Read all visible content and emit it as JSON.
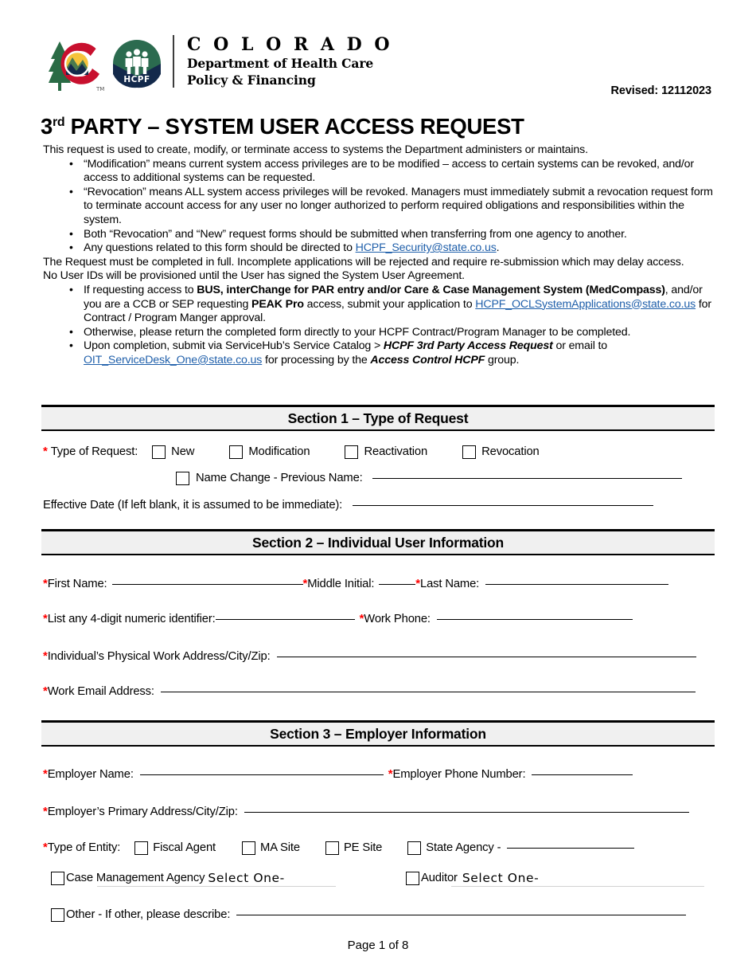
{
  "logo": {
    "colorado_wordmark": "C O L O R A D O",
    "department_line1": "Department of Health Care",
    "department_line2": "Policy & Financing",
    "hcpf_label": "HCPF",
    "colors": {
      "red": "#c8102e",
      "gold": "#ffc425",
      "navy": "#13294b",
      "green": "#1e5c3f",
      "dark_green": "#2b6b4f"
    }
  },
  "revised": "Revised: 12112023",
  "title": {
    "prefix": "3",
    "sup": "rd",
    "rest": " PARTY – SYSTEM USER ACCESS REQUEST"
  },
  "intro": {
    "lead": "This request is used to create, modify, or terminate access to systems the Department administers or maintains.",
    "bullets": [
      "“Modification” means current system access privileges are to be modified – access to certain systems can be revoked, and/or access to additional systems can be requested.",
      "“Revocation” means ALL system access privileges will be revoked. Managers must immediately submit a revocation request form to terminate account access for any user no longer authorized to perform required obligations and responsibilities within the system.",
      "Both “Revocation” and “New” request forms should be submitted when transferring from one agency to another."
    ],
    "bullet_question_prefix": "Any questions related to this form should be directed to ",
    "bullet_question_email": "HCPF_Security@state.co.us",
    "bullet_question_suffix": ".",
    "para2_line1": "The Request must be completed in full. Incomplete applications will be rejected and require re-submission which may delay access.",
    "para2_line2": "No User IDs will be provisioned until the User has signed the System User Agreement.",
    "bullet_bus_p1": "If requesting access to ",
    "bullet_bus_b1": "BUS, interChange for PAR entry and/or Care & Case Management System (MedCompass)",
    "bullet_bus_p2": ", and/or you are a CCB or SEP requesting ",
    "bullet_bus_b2": "PEAK Pro",
    "bullet_bus_p3": " access, submit your application to ",
    "bullet_bus_email": "HCPF_OCLSystemApplications@state.co.us",
    "bullet_bus_p4": " for Contract / Program Manger approval.",
    "bullet_otherwise": "Otherwise, please return the completed form directly to your HCPF Contract/Program Manager to be completed.",
    "bullet_submit_p1": "Upon completion, submit via ServiceHub’s Service Catalog > ",
    "bullet_submit_b1": "HCPF 3rd Party Access Request",
    "bullet_submit_p2": " or email to ",
    "bullet_submit_email": "OIT_ServiceDesk_One@state.co.us",
    "bullet_submit_p3": " for processing by the ",
    "bullet_submit_b2": "Access Control HCPF",
    "bullet_submit_p4": " group."
  },
  "section1": {
    "heading": "Section 1 – Type of Request",
    "type_label": "Type of Request:",
    "options": [
      "New",
      "Modification",
      "Reactivation",
      "Revocation"
    ],
    "name_change_label": "Name Change - Previous Name:",
    "effective_date_label": "Effective Date (If left blank, it is assumed to be immediate):"
  },
  "section2": {
    "heading": "Section 2 – Individual User Information",
    "first_name": "First Name:",
    "middle_initial": "Middle Initial:",
    "last_name": "Last Name:",
    "numeric_identifier": "List any 4-digit numeric identifier:",
    "work_phone": "Work Phone:",
    "physical_address": "Individual’s Physical Work Address/City/Zip:",
    "work_email": "Work Email Address:"
  },
  "section3": {
    "heading": "Section 3 – Employer Information",
    "employer_name": "Employer Name:",
    "employer_phone": "Employer Phone Number:",
    "employer_address": "Employer’s Primary Address/City/Zip:",
    "type_of_entity": "Type of Entity:",
    "entity_options": [
      "Fiscal Agent",
      "MA Site",
      "PE Site"
    ],
    "state_agency": "State Agency -",
    "case_management_agency": "Case Management Agency",
    "case_management_value": "Select One-",
    "auditor": "Auditor",
    "auditor_value": "Select One-",
    "other_label": "Other - If other, please describe:"
  },
  "footer": "Page 1 of 8"
}
